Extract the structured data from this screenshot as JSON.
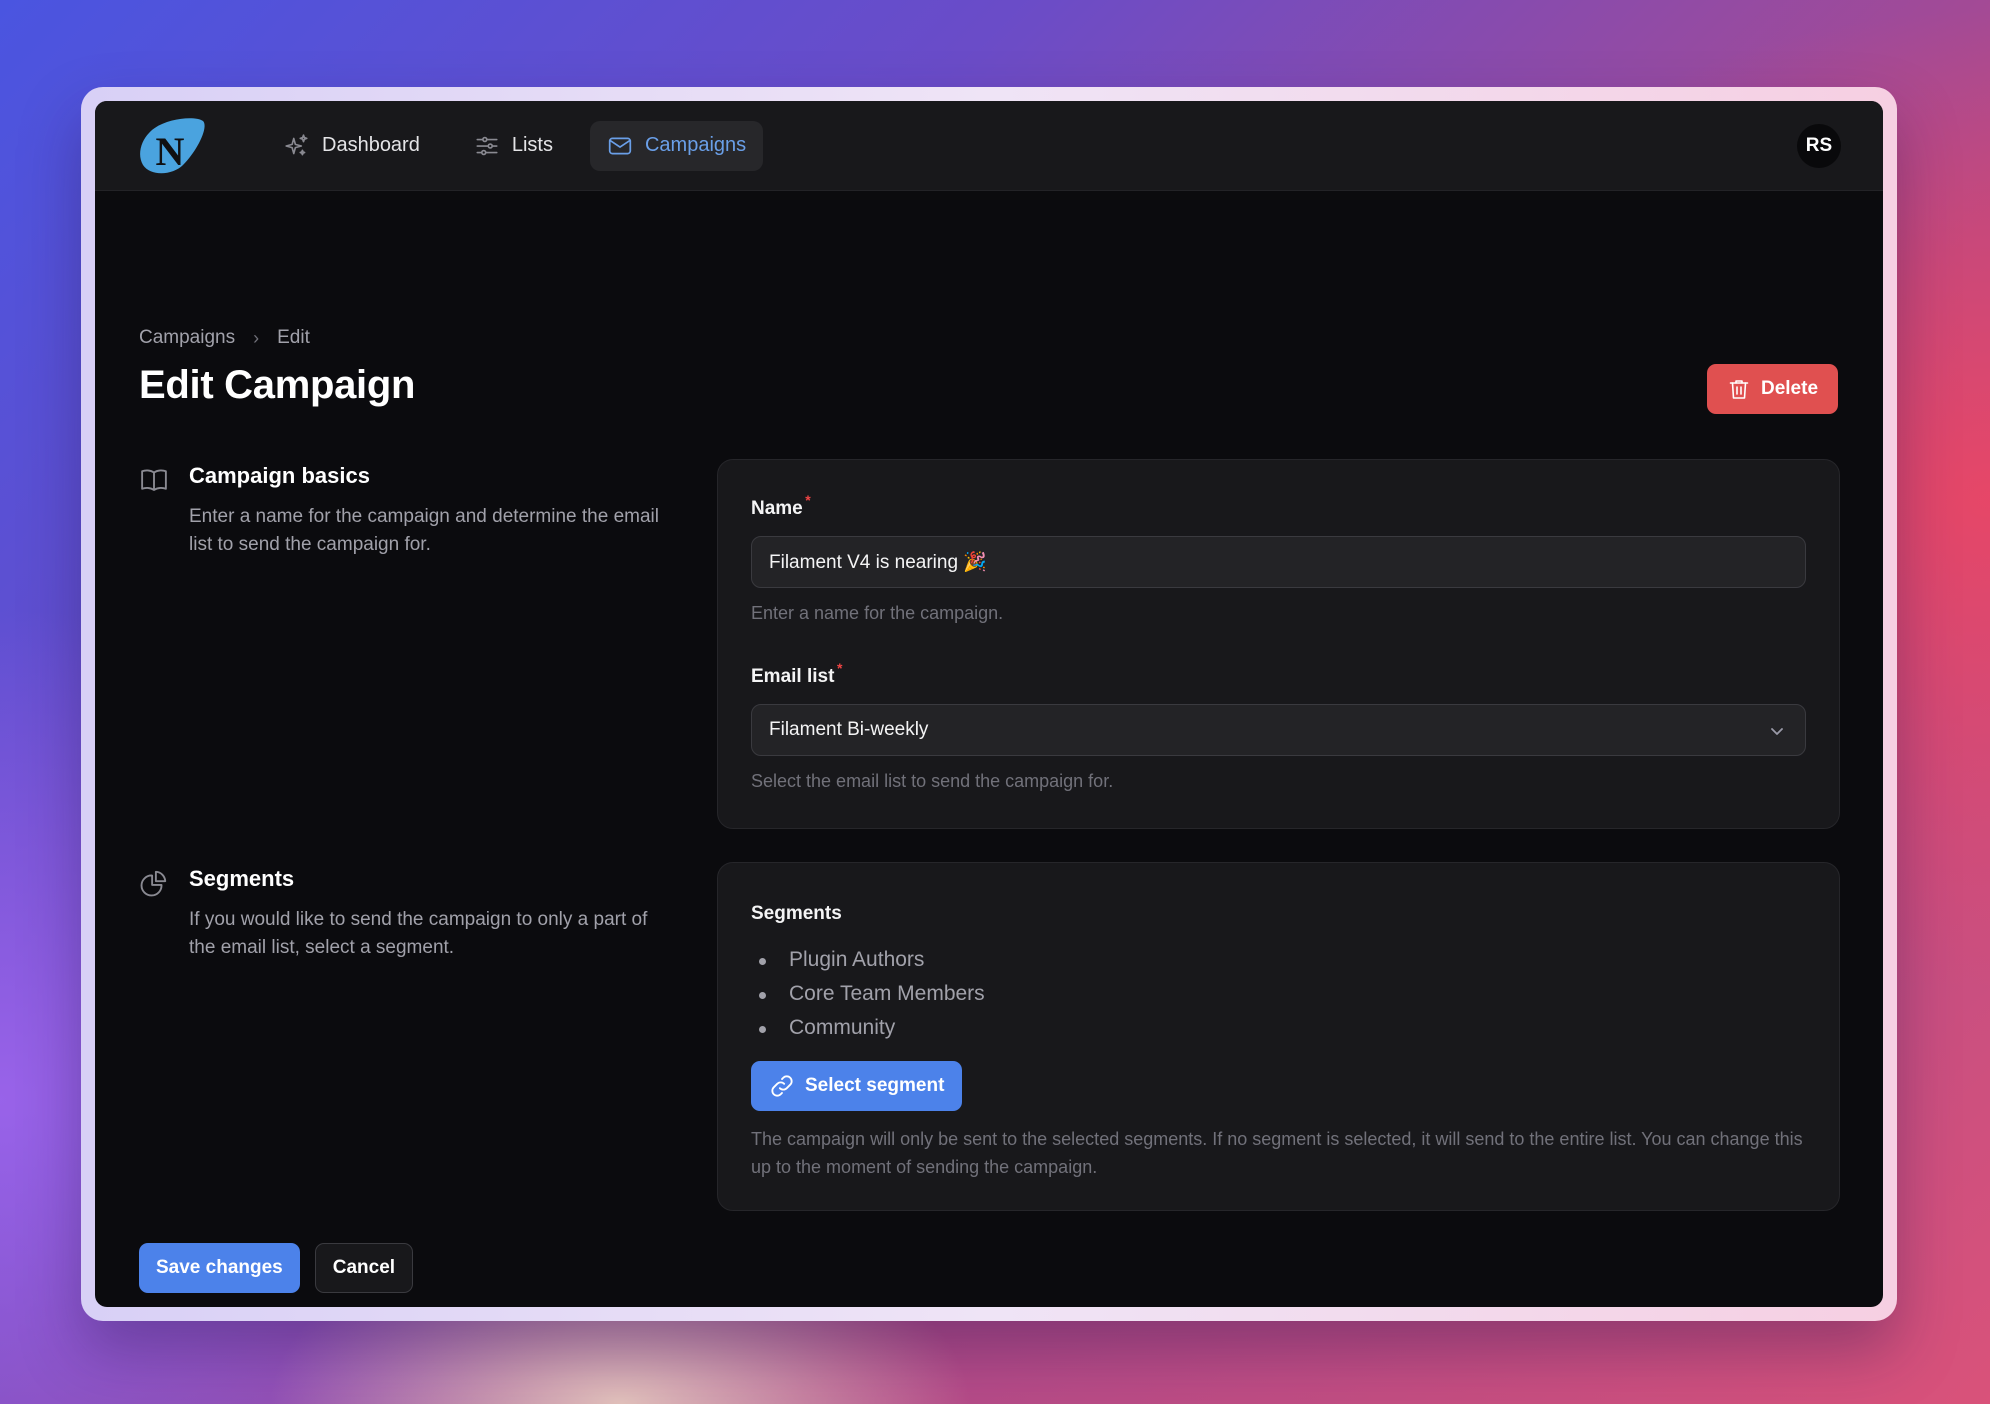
{
  "colors": {
    "accent": "#4c82ea",
    "active_nav": "#6a9fe8",
    "danger": "#e05050",
    "required": "#ef4444",
    "logo": "#4aa3df"
  },
  "header": {
    "logo_letter": "N",
    "nav": [
      {
        "label": "Dashboard",
        "icon": "sparkles-icon",
        "active": false
      },
      {
        "label": "Lists",
        "icon": "sliders-icon",
        "active": false
      },
      {
        "label": "Campaigns",
        "icon": "envelope-icon",
        "active": true
      }
    ],
    "avatar_initials": "RS"
  },
  "breadcrumb": {
    "items": [
      "Campaigns",
      "Edit"
    ],
    "separator": "›"
  },
  "page": {
    "title": "Edit Campaign",
    "delete_label": "Delete"
  },
  "sections": {
    "basics": {
      "icon": "book-open-icon",
      "title": "Campaign basics",
      "description": "Enter a name for the campaign and determine the email list to send the campaign for."
    },
    "segments": {
      "icon": "chart-pie-icon",
      "title": "Segments",
      "description": "If you would like to send the campaign to only a part of the email list, select a segment."
    }
  },
  "form": {
    "name": {
      "label": "Name",
      "required_mark": "*",
      "value": "Filament V4 is nearing 🎉",
      "hint": "Enter a name for the campaign."
    },
    "email_list": {
      "label": "Email list",
      "required_mark": "*",
      "selected": "Filament Bi-weekly",
      "hint": "Select the email list to send the campaign for."
    },
    "segments": {
      "label": "Segments",
      "items": [
        "Plugin Authors",
        "Core Team Members",
        "Community"
      ],
      "select_label": "Select segment",
      "note": "The campaign will only be sent to the selected segments. If no segment is selected, it will send to the entire list. You can change this up to the moment of sending the campaign."
    }
  },
  "actions": {
    "save_label": "Save changes",
    "cancel_label": "Cancel"
  }
}
